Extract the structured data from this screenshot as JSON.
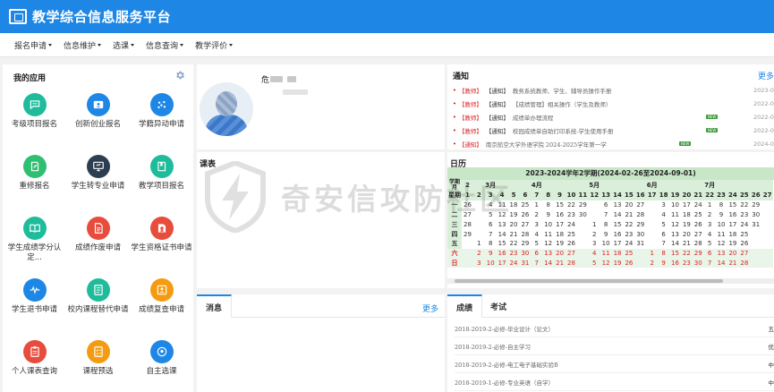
{
  "header": {
    "title": "教学综合信息服务平台"
  },
  "menu": [
    {
      "label": "报名申请"
    },
    {
      "label": "信息维护"
    },
    {
      "label": "选课"
    },
    {
      "label": "信息查询"
    },
    {
      "label": "教学评价"
    }
  ],
  "apps_panel": {
    "title": "我的应用",
    "items": [
      {
        "label": "考级项目报名",
        "icon": "chat-icon",
        "color": "#1fbc9c"
      },
      {
        "label": "创新创业报名",
        "icon": "id-card-icon",
        "color": "#1e87e5"
      },
      {
        "label": "学籍异动申请",
        "icon": "dots-icon",
        "color": "#1e87e5"
      },
      {
        "label": "重修报名",
        "icon": "leaf-book-icon",
        "color": "#2fbf71"
      },
      {
        "label": "学生转专业申请",
        "icon": "monitor-icon",
        "color": "#2c3e50"
      },
      {
        "label": "教学项目报名",
        "icon": "book-icon",
        "color": "#1fbc9c"
      },
      {
        "label": "学生成绩学分认定...",
        "icon": "open-book-icon",
        "color": "#1fbc9c"
      },
      {
        "label": "成绩作废申请",
        "icon": "document-icon",
        "color": "#e74c3c"
      },
      {
        "label": "学生资格证书申请",
        "icon": "certificate-icon",
        "color": "#e74c3c"
      },
      {
        "label": "学生退书申请",
        "icon": "pulse-icon",
        "color": "#1e87e5"
      },
      {
        "label": "校内课程替代申请",
        "icon": "list-doc-icon",
        "color": "#1fbc9c"
      },
      {
        "label": "成绩复查申请",
        "icon": "person-doc-icon",
        "color": "#f39c12"
      },
      {
        "label": "个人课表查询",
        "icon": "clipboard-icon",
        "color": "#e74c3c"
      },
      {
        "label": "课程预选",
        "icon": "checklist-icon",
        "color": "#f39c12"
      },
      {
        "label": "自主选课",
        "icon": "ball-icon",
        "color": "#1e87e5"
      }
    ]
  },
  "profile": {
    "name_initial": "危"
  },
  "notices": {
    "title": "通知",
    "more": "更多",
    "items": [
      {
        "tag1": "【教师】",
        "tag2": "【通知】",
        "text": "教务系统教师、学生、辅导员操作手册",
        "new": "",
        "date": "2023-0"
      },
      {
        "tag1": "【教师】",
        "tag2": "【通知】",
        "text": "【成绩管理】相关操作（学生及教师）",
        "new": "",
        "date": "2022-0"
      },
      {
        "tag1": "【教师】",
        "tag2": "【通知】",
        "text": "成绩单办理流程",
        "new": "NEW",
        "date": "2022-0"
      },
      {
        "tag1": "【教师】",
        "tag2": "【通知】",
        "text": "校园成绩单自助打印系统-学生使用手册",
        "new": "NEW",
        "date": "2022-0"
      },
      {
        "tag1": "【通知】",
        "tag2": "",
        "text": "南京航空大学外语学院 2024-2025学年第一学",
        "new": "NEW",
        "date": "2024-0"
      }
    ]
  },
  "schedule": {
    "title": "课表"
  },
  "calendar": {
    "title": "日历",
    "header": "2023-2024学年2学期(2024-02-26至2024-09-01)",
    "week_label": "学期",
    "week_label_sub": "月",
    "rows": [
      {
        "label": "周",
        "cells": [
          "2",
          "",
          "3月",
          "",
          "",
          "",
          "4月",
          "",
          "",
          "",
          "",
          "5月",
          "",
          "",
          "",
          "",
          "6月",
          "",
          "",
          "",
          "",
          "7月",
          "",
          "",
          "",
          "",
          ""
        ]
      },
      {
        "label": "星期",
        "cells": [
          "1",
          "2",
          "3",
          "4",
          "5",
          "6",
          "7",
          "8",
          "9",
          "10",
          "11",
          "12",
          "13",
          "14",
          "15",
          "16",
          "17",
          "18",
          "19",
          "20",
          "21",
          "22",
          "23",
          "24",
          "25",
          "26",
          "27"
        ]
      },
      {
        "label": "一",
        "cells": [
          "26",
          "",
          "4",
          "11",
          "18",
          "25",
          "1",
          "8",
          "15",
          "22",
          "29",
          "",
          "6",
          "13",
          "20",
          "27",
          "",
          "3",
          "10",
          "17",
          "24",
          "1",
          "8",
          "15",
          "22",
          "29",
          ""
        ]
      },
      {
        "label": "二",
        "cells": [
          "27",
          "",
          "5",
          "12",
          "19",
          "26",
          "2",
          "9",
          "16",
          "23",
          "30",
          "",
          "7",
          "14",
          "21",
          "28",
          "",
          "4",
          "11",
          "18",
          "25",
          "2",
          "9",
          "16",
          "23",
          "30",
          ""
        ]
      },
      {
        "label": "三",
        "cells": [
          "28",
          "",
          "6",
          "13",
          "20",
          "27",
          "3",
          "10",
          "17",
          "24",
          "",
          "1",
          "8",
          "15",
          "22",
          "29",
          "",
          "5",
          "12",
          "19",
          "26",
          "3",
          "10",
          "17",
          "24",
          "31",
          ""
        ]
      },
      {
        "label": "四",
        "cells": [
          "29",
          "",
          "7",
          "14",
          "21",
          "28",
          "4",
          "11",
          "18",
          "25",
          "",
          "2",
          "9",
          "16",
          "23",
          "30",
          "",
          "6",
          "13",
          "20",
          "27",
          "4",
          "11",
          "18",
          "25",
          "",
          ""
        ]
      },
      {
        "label": "五",
        "cells": [
          "",
          "1",
          "8",
          "15",
          "22",
          "29",
          "5",
          "12",
          "19",
          "26",
          "",
          "3",
          "10",
          "17",
          "24",
          "31",
          "",
          "7",
          "14",
          "21",
          "28",
          "5",
          "12",
          "19",
          "26",
          "",
          ""
        ]
      },
      {
        "label": "六",
        "cells": [
          "",
          "2",
          "9",
          "16",
          "23",
          "30",
          "6",
          "13",
          "20",
          "27",
          "",
          "4",
          "11",
          "18",
          "25",
          "",
          "1",
          "8",
          "15",
          "22",
          "29",
          "6",
          "13",
          "20",
          "27",
          "",
          ""
        ]
      },
      {
        "label": "日",
        "cells": [
          "",
          "3",
          "10",
          "17",
          "24",
          "31",
          "7",
          "14",
          "21",
          "28",
          "",
          "5",
          "12",
          "19",
          "26",
          "",
          "2",
          "9",
          "16",
          "23",
          "30",
          "7",
          "14",
          "21",
          "28",
          "",
          ""
        ]
      }
    ]
  },
  "messages": {
    "tab": "消息",
    "more": "更多"
  },
  "grades": {
    "tab_grades": "成绩",
    "tab_exams": "考试",
    "items": [
      {
        "course": "2018-2019-2-必修-毕业设计（论文）",
        "value": "五"
      },
      {
        "course": "2018-2019-2-必修-自主学习",
        "value": "优"
      },
      {
        "course": "2018-2019-2-必修-电工电子基础实验B",
        "value": "中"
      },
      {
        "course": "2018-2019-1-必修-专业英语（自学）",
        "value": "中"
      }
    ]
  },
  "watermark": {
    "text": "奇安信攻防社区"
  }
}
